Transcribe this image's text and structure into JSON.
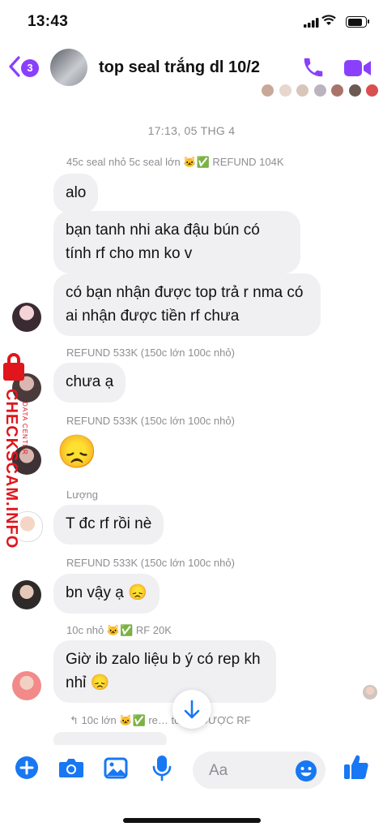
{
  "status_bar": {
    "time": "13:43"
  },
  "header": {
    "back_badge": "3",
    "title": "top seal trắng dl 10/2",
    "accent_color": "#8a3ffc",
    "icons": [
      "back-chevron-icon",
      "phone-icon",
      "video-camera-icon"
    ]
  },
  "chat": {
    "date_separator": "17:13, 05 THG 4",
    "messages": [
      {
        "sender_line": "45c seal nhỏ 5c seal lớn 🐱✅ REFUND 104K",
        "bubbles": [
          "alo",
          "bạn tanh nhi aka đậu bún có tính rf cho mn ko v",
          "có bạn nhận được top trả r nma có ai nhận được tiền rf chưa"
        ]
      },
      {
        "sender_line": "REFUND 533K (150c lớn 100c nhỏ)",
        "bubbles": [
          "chưa ạ"
        ]
      },
      {
        "sender_line": "REFUND 533K (150c lớn 100c nhỏ)",
        "emoji": "😞"
      },
      {
        "sender_line": "Lượng",
        "bubbles": [
          "T đc rf rồi nè"
        ]
      },
      {
        "sender_line": "REFUND 533K (150c lớn 100c nhỏ)",
        "bubbles": [
          "bn vậy ạ 😞"
        ]
      },
      {
        "sender_line": "10c nhỏ 🐱✅ RF 20K",
        "bubbles": [
          "Giờ ib zalo liệu b ý có rep kh nhỉ 😞"
        ]
      }
    ],
    "reply_line": "↰ 10c lớn 🐱✅ re… to ĐÃ ĐƯỢC RF"
  },
  "watermark": {
    "text": "CHECKSCAM.INFO",
    "sub": "DATA CENTER",
    "color": "#e0161c"
  },
  "composer": {
    "placeholder": "Aa",
    "icons": [
      "plus-icon",
      "camera-icon",
      "image-icon",
      "microphone-icon",
      "emoji-icon",
      "thumbs-up-icon"
    ],
    "accent_color": "#1877f2"
  }
}
